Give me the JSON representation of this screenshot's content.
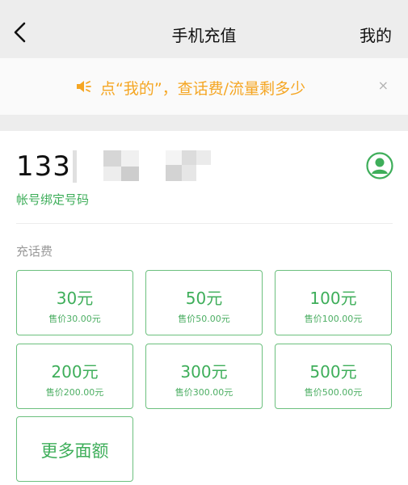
{
  "nav": {
    "title": "手机充值",
    "right_link": "我的"
  },
  "notice": {
    "text": "点“我的”，查话费/流量剩多少",
    "close": "×"
  },
  "account": {
    "number_visible": "133",
    "label": "帐号绑定号码"
  },
  "section_label": "充话费",
  "options": [
    {
      "amount": "30元",
      "price": "售价30.00元"
    },
    {
      "amount": "50元",
      "price": "售价50.00元"
    },
    {
      "amount": "100元",
      "price": "售价100.00元"
    },
    {
      "amount": "200元",
      "price": "售价200.00元"
    },
    {
      "amount": "300元",
      "price": "售价300.00元"
    },
    {
      "amount": "500元",
      "price": "售价500.00元"
    }
  ],
  "more_label": "更多面额",
  "colors": {
    "accent_green": "#3eae5a",
    "notice_orange": "#f5a623"
  },
  "icons": [
    "back-chevron-icon",
    "speaker-icon",
    "close-icon",
    "user-avatar-icon"
  ]
}
